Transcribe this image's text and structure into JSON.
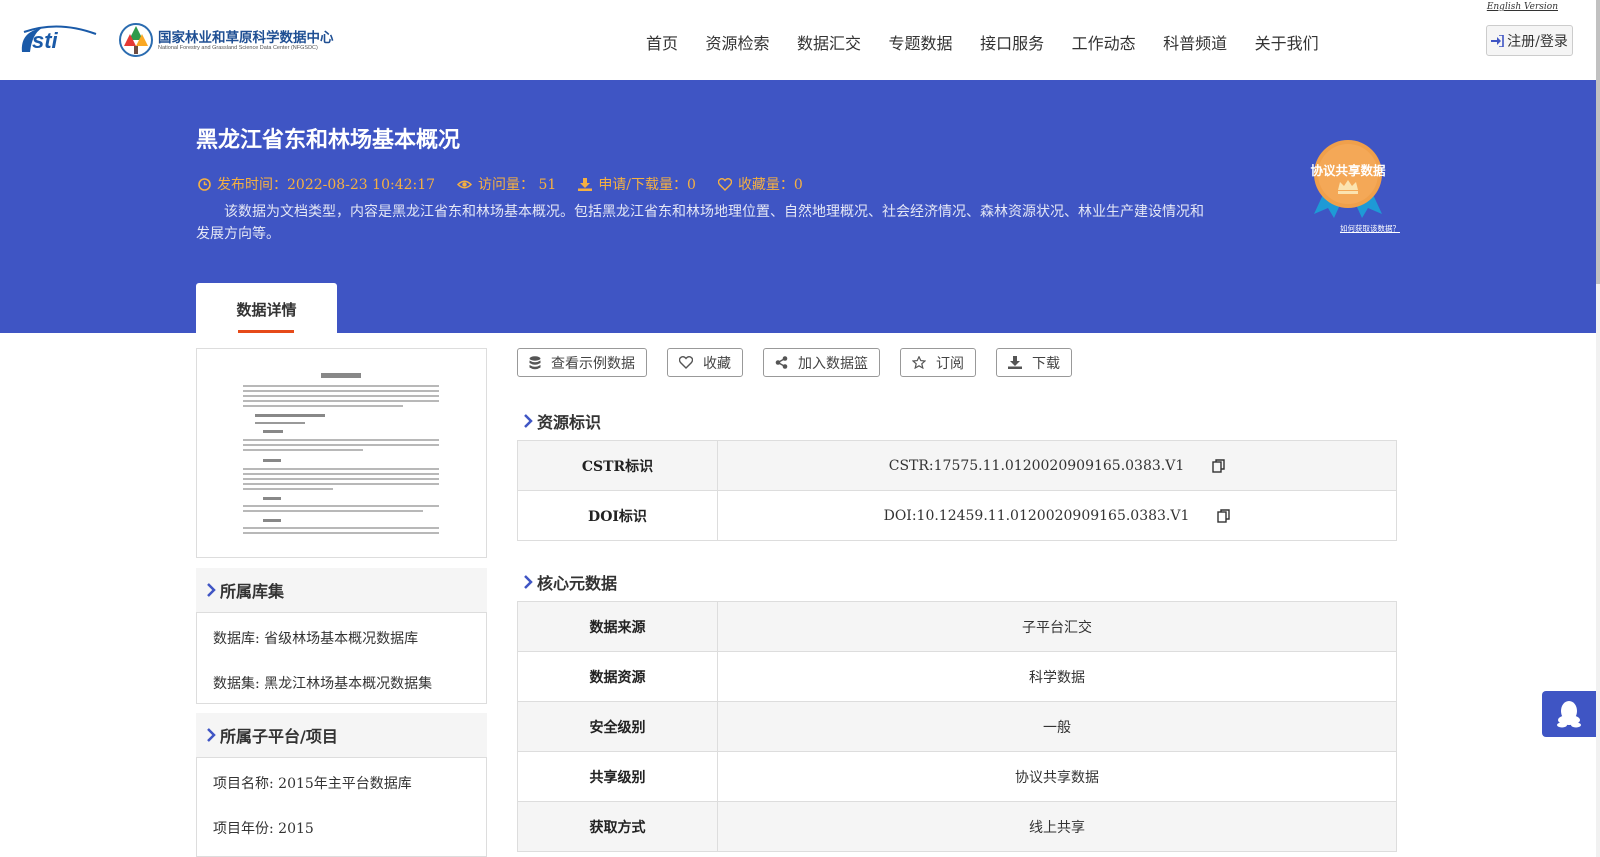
{
  "header": {
    "english_link": "English Version",
    "logo_title": "国家林业和草原科学数据中心",
    "logo_subtitle": "National Forestry and Grassland Science Data Center (NFGSDC)",
    "nav": [
      "首页",
      "资源检索",
      "数据汇交",
      "专题数据",
      "接口服务",
      "工作动态",
      "科普频道",
      "关于我们"
    ],
    "login_label": "注册/登录"
  },
  "banner": {
    "title": "黑龙江省东和林场基本概况",
    "publish_time": "发布时间：2022-08-23 10:42:17",
    "views": "访问量：  51",
    "downloads": "申请/下载量：0",
    "favorites": "收藏量：0",
    "description": "该数据为文档类型，内容是黑龙江省东和林场基本概况。包括黑龙江省东和林场地理位置、自然地理概况、社会经济情况、森林资源状况、林业生产建设情况和发展方向等。",
    "badge_label": "协议共享数据",
    "how_to_get": "如何获取该数据？",
    "tab_label": "数据详情"
  },
  "sidebar": {
    "library_title": "所属库集",
    "database": "数据库: 省级林场基本概况数据库",
    "dataset": "数据集: 黑龙江林场基本概况数据集",
    "platform_title": "所属子平台/项目",
    "project_name": "项目名称: 2015年主平台数据库",
    "project_year": "项目年份: 2015"
  },
  "actions": {
    "sample": "查看示例数据",
    "favorite": "收藏",
    "basket": "加入数据篮",
    "subscribe": "订阅",
    "download": "下载"
  },
  "identifiers": {
    "title": "资源标识",
    "rows": [
      {
        "key": "CSTR标识",
        "value": "CSTR:17575.11.0120020909165.0383.V1"
      },
      {
        "key": "DOI标识",
        "value": "DOI:10.12459.11.0120020909165.0383.V1"
      }
    ]
  },
  "core_metadata": {
    "title": "核心元数据",
    "rows": [
      {
        "key": "数据来源",
        "value": "子平台汇交"
      },
      {
        "key": "数据资源",
        "value": "科学数据"
      },
      {
        "key": "安全级别",
        "value": "一般"
      },
      {
        "key": "共享级别",
        "value": "协议共享数据"
      },
      {
        "key": "获取方式",
        "value": "线上共享"
      }
    ]
  },
  "colors": {
    "banner": "#3f55c4",
    "meta_accent": "#f5b042",
    "tab_underline": "#e64a19",
    "chevron": "#3f55c4"
  }
}
